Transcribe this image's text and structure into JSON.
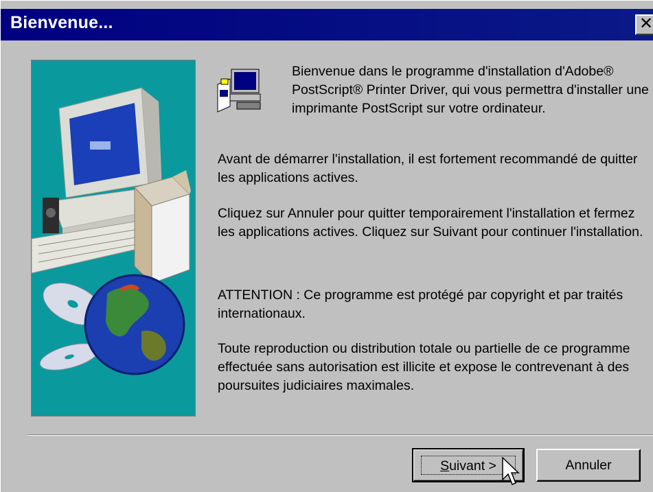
{
  "window": {
    "title": "Bienvenue...",
    "close_glyph": "✕"
  },
  "icons": {
    "setup": "computer-setup-icon",
    "side_art": "computer-cd-globe-illustration",
    "cursor": "mouse-pointer-icon"
  },
  "content": {
    "intro": "Bienvenue dans le programme d'installation d'Adobe® PostScript® Printer Driver, qui vous permettra d'installer une imprimante PostScript sur votre ordinateur.",
    "para2": "Avant de démarrer l'installation, il est fortement recommandé de quitter les applications actives.",
    "para3": "Cliquez sur Annuler pour quitter temporairement l'installation et fermez les applications actives. Cliquez sur Suivant pour continuer l'installation.",
    "para4": "ATTENTION : Ce programme est protégé par copyright et par traités internationaux.",
    "para5": "Toute reproduction ou distribution totale ou partielle de ce programme effectuée sans autorisation est illicite et expose le contrevenant à des poursuites judiciaires maximales."
  },
  "buttons": {
    "next_mnemonic": "S",
    "next_rest": "uivant >",
    "cancel": "Annuler"
  },
  "colors": {
    "titlebar": "#000080",
    "dialog": "#c0c0c0",
    "art_background": "#0a9a9e"
  }
}
